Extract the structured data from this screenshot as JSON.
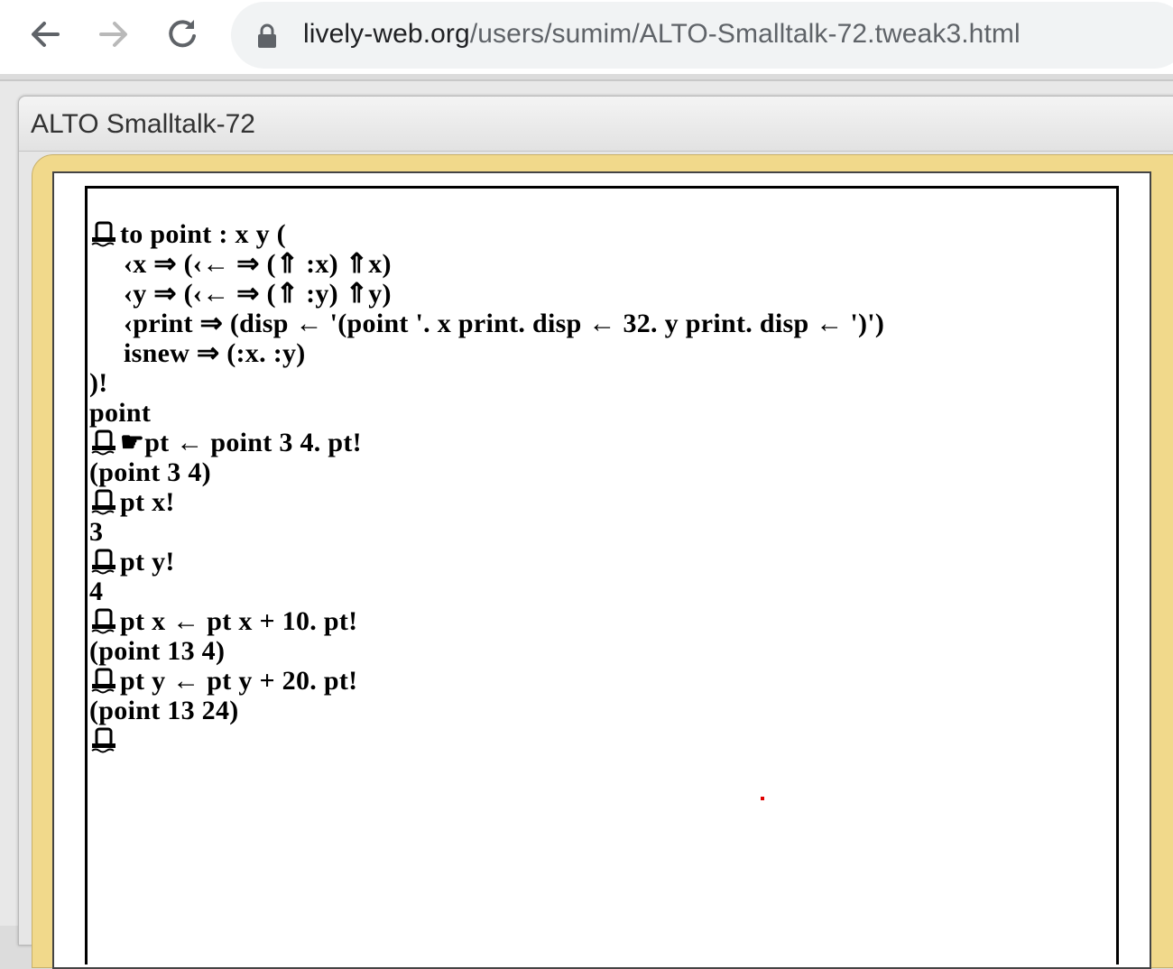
{
  "browser": {
    "url_host": "lively-web.org",
    "url_path": "/users/sumim/ALTO-Smalltalk-72.tweak3.html"
  },
  "window": {
    "title": "ALTO Smalltalk-72"
  },
  "transcript": [
    {
      "prompt": true,
      "text": "to point : x y ("
    },
    {
      "prompt": false,
      "indent": true,
      "text": "‹x ⇒ (‹← ⇒ (⇑ :x) ⇑x)"
    },
    {
      "prompt": false,
      "indent": true,
      "text": "‹y ⇒ (‹← ⇒ (⇑ :y) ⇑y)"
    },
    {
      "prompt": false,
      "indent": true,
      "text": "‹print ⇒ (disp ← '(point '. x print. disp ← 32. y print. disp ← ')')"
    },
    {
      "prompt": false,
      "indent": true,
      "text": "isnew ⇒ (:x. :y)"
    },
    {
      "prompt": false,
      "text": ")!"
    },
    {
      "prompt": false,
      "text": "point"
    },
    {
      "prompt": true,
      "text": "☛pt ← point 3 4. pt!"
    },
    {
      "prompt": false,
      "text": "(point 3 4)"
    },
    {
      "prompt": true,
      "text": "pt x!"
    },
    {
      "prompt": false,
      "text": "3"
    },
    {
      "prompt": true,
      "text": "pt y!"
    },
    {
      "prompt": false,
      "text": "4"
    },
    {
      "prompt": true,
      "text": "pt x ← pt x + 10. pt!"
    },
    {
      "prompt": false,
      "text": "(point 13 4)"
    },
    {
      "prompt": true,
      "text": "pt y ← pt y + 20. pt!"
    },
    {
      "prompt": false,
      "text": "(point 13 24)"
    },
    {
      "prompt": true,
      "text": ""
    }
  ],
  "icons": {
    "back": "arrow-left-icon",
    "forward": "arrow-right-icon",
    "reload": "reload-icon",
    "secure": "lock-icon",
    "prompt": "alto-prompt-glyph-icon",
    "cursor_marker": "red-dot"
  },
  "colors": {
    "frame": "#f1d98b",
    "cursor_marker": "#e00000"
  }
}
